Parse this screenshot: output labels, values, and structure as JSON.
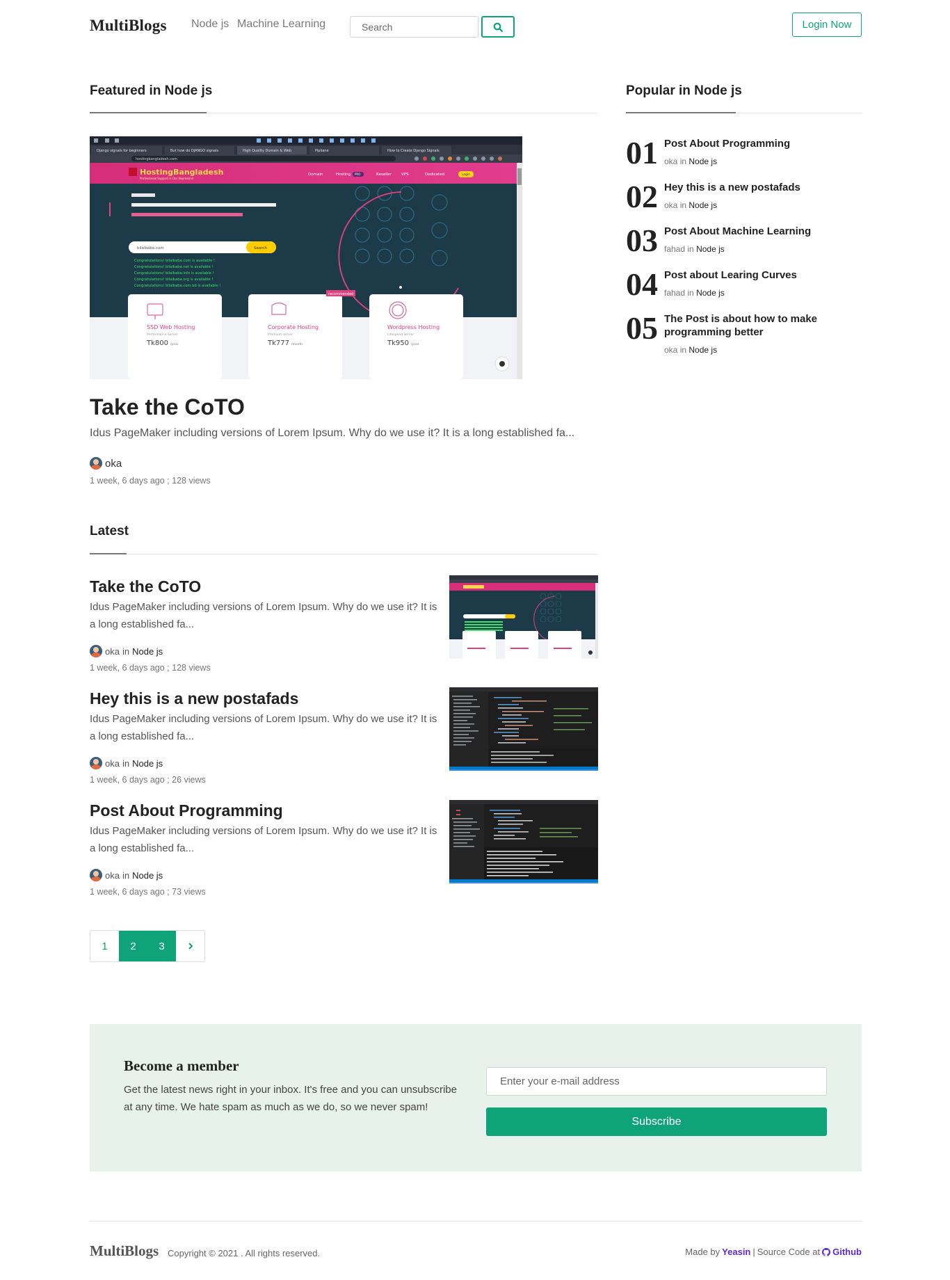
{
  "header": {
    "brand": "MultiBlogs",
    "nav": [
      "Node js",
      "Machine Learning"
    ],
    "search_placeholder": "Search",
    "login_label": "Login Now"
  },
  "featured": {
    "heading": "Featured in Node js",
    "title": "Take the CoTO",
    "excerpt": "Idus PageMaker including versions of Lorem Ipsum. Why do we use it? It is a long established fa...",
    "author": "oka",
    "meta": "1 week, 6 days ago ; 128 views",
    "image": {
      "tabs": [
        "Django signals for beginners",
        "But how do DJANGO signals",
        "High Quality Domain & Web",
        "Pipliane",
        "How to Create Django Signals"
      ],
      "url": "hostingbangladesh.com",
      "site_name": "HostingBangladesh",
      "site_tagline": "Professional Support is Our Impression",
      "site_nav": [
        "Domain",
        "Hosting",
        "PRO",
        "Reseller",
        "VPS",
        "Dedicated",
        "Login"
      ],
      "domain_input": "bilalbaba.com",
      "search_btn": "Search",
      "available": [
        "Congratulations! bilalbaba.com is available !",
        "Congratulations! bilalbaba.net is available !",
        "Congratulations! bilalbaba.info is available !",
        "Congratulations! bilalbaba.org is available !",
        "Congratulations! bilalbaba.com.bd is available !"
      ],
      "cards": [
        {
          "name": "SSD Web Hosting",
          "sub": "Performance Server",
          "price": "Tk800",
          "per": "/year"
        },
        {
          "name": "Corporate Hosting",
          "sub": "Premium server",
          "price": "Tk777",
          "per": "/month",
          "badge": "recommended"
        },
        {
          "name": "Wordpress Hosting",
          "sub": "Litespeed Server",
          "price": "Tk950",
          "per": "/year"
        }
      ]
    }
  },
  "latest": {
    "heading": "Latest",
    "posts": [
      {
        "title": "Take the CoTO",
        "excerpt": "Idus PageMaker including versions of Lorem Ipsum. Why do we use it? It is a long established fa...",
        "author": "oka",
        "in_text": "in",
        "category": "Node js",
        "meta": "1 week, 6 days ago ; 128 views"
      },
      {
        "title": "Hey this is a new postafads",
        "excerpt": "Idus PageMaker including versions of Lorem Ipsum. Why do we use it? It is a long established fa...",
        "author": "oka",
        "in_text": "in",
        "category": "Node js",
        "meta": "1 week, 6 days ago ; 26 views"
      },
      {
        "title": "Post About Programming",
        "excerpt": "Idus PageMaker including versions of Lorem Ipsum. Why do we use it? It is a long established fa...",
        "author": "oka",
        "in_text": "in",
        "category": "Node js",
        "meta": "1 week, 6 days ago ; 73 views"
      }
    ]
  },
  "pagination": {
    "pages": [
      "1",
      "2",
      "3"
    ],
    "active": [
      "2",
      "3"
    ],
    "next_icon": "chevron-right-icon"
  },
  "popular": {
    "heading": "Popular in Node js",
    "items": [
      {
        "num": "01",
        "title": "Post About Programming",
        "author": "oka",
        "in_text": "in",
        "category": "Node js"
      },
      {
        "num": "02",
        "title": "Hey this is a new postafads",
        "author": "oka",
        "in_text": "in",
        "category": "Node js"
      },
      {
        "num": "03",
        "title": "Post About Machine Learning",
        "author": "fahad",
        "in_text": "in",
        "category": "Node js"
      },
      {
        "num": "04",
        "title": "Post about Learing Curves",
        "author": "fahad",
        "in_text": "in",
        "category": "Node js"
      },
      {
        "num": "05",
        "title": "The Post is about how to make programming better",
        "author": "oka",
        "in_text": "in",
        "category": "Node js"
      }
    ]
  },
  "member": {
    "title": "Become a member",
    "text": "Get the latest news right in your inbox. It's free and you can unsubscribe at any time. We hate spam as much as we do, so we never spam!",
    "email_placeholder": "Enter your e-mail address",
    "subscribe_label": "Subscribe"
  },
  "footer": {
    "brand": "MultiBlogs",
    "copyright": "Copyright © 2021 . All rights reserved.",
    "made_by": "Made by",
    "author": "Yeasin",
    "separator": "|",
    "source_text": "Source Code at",
    "source_link": "Github"
  },
  "colors": {
    "accent": "#0fa37a",
    "member_bg": "#e7f2ec",
    "link_purple": "#5a2ad6"
  }
}
